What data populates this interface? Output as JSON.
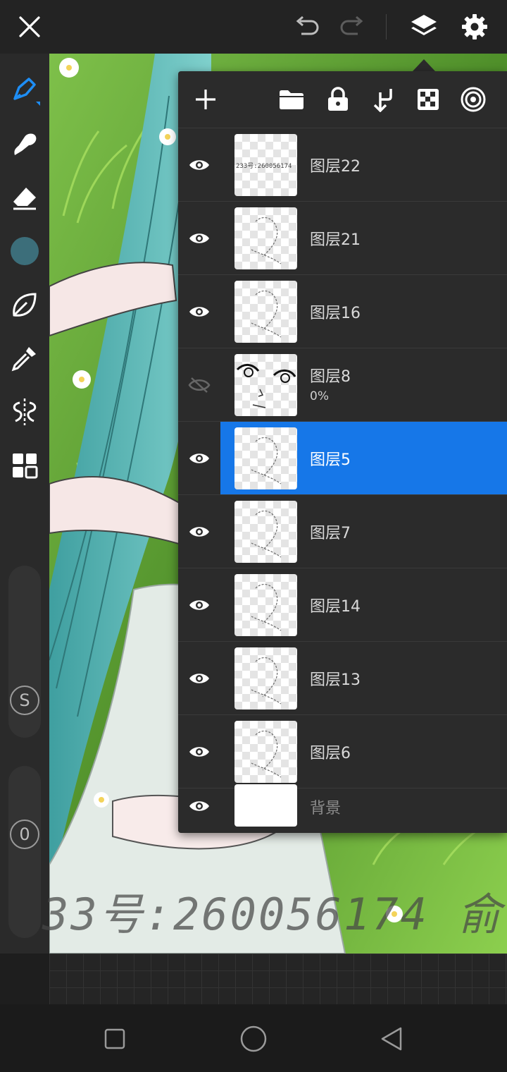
{
  "topbar": {
    "close_icon": "close-icon",
    "undo_icon": "undo-icon",
    "redo_icon": "redo-icon",
    "layers_icon": "layers-icon",
    "settings_icon": "gear-icon"
  },
  "tools": [
    "brush-icon",
    "smudge-icon",
    "eraser-icon",
    "color-swatch",
    "leaf-icon",
    "eyedropper-icon",
    "symmetry-icon",
    "grid-icon"
  ],
  "colors": {
    "accent": "#1677e8",
    "current_color": "#3c6e7a",
    "panel_bg": "#2b2b2b"
  },
  "sliders": {
    "size_label": "S",
    "opacity_label": "0"
  },
  "layers_panel": {
    "toolbar": [
      "add-icon",
      "folder-icon",
      "lock-icon",
      "merge-down-icon",
      "transparency-icon",
      "blend-icon"
    ],
    "layers": [
      {
        "name": "图层22",
        "visible": true,
        "active": false
      },
      {
        "name": "图层21",
        "visible": true,
        "active": false
      },
      {
        "name": "图层16",
        "visible": true,
        "active": false
      },
      {
        "name": "图层8",
        "visible": false,
        "active": false,
        "opacity": "0%"
      },
      {
        "name": "图层5",
        "visible": true,
        "active": true
      },
      {
        "name": "图层7",
        "visible": true,
        "active": false
      },
      {
        "name": "图层14",
        "visible": true,
        "active": false
      },
      {
        "name": "图层13",
        "visible": true,
        "active": false
      },
      {
        "name": "图层6",
        "visible": true,
        "active": false
      },
      {
        "name": "背景",
        "visible": true,
        "active": false
      }
    ],
    "thumb_text": "233号:260056174 俞"
  },
  "canvas": {
    "watermark": "33号:260056174 俞"
  },
  "navbar": [
    "recents-icon",
    "home-icon",
    "back-icon"
  ]
}
